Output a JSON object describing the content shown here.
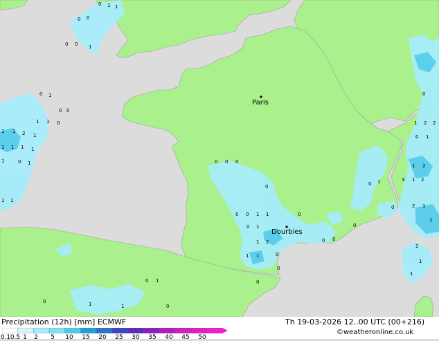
{
  "map": {
    "cities": [
      {
        "name": "Paris"
      },
      {
        "name": "Dourbies"
      }
    ]
  },
  "legend": {
    "title": "Precipitation (12h) [mm]",
    "model": "ECMWF",
    "ticks": [
      "0.1",
      "0.5",
      "1",
      "2",
      "5",
      "10",
      "15",
      "20",
      "25",
      "30",
      "35",
      "40",
      "45",
      "50"
    ],
    "colors": [
      "#ffffff",
      "#d4f4fa",
      "#a6ecfa",
      "#7ee1f5",
      "#4fc9ea",
      "#1e9fd8",
      "#2f6fd0",
      "#3a45c8",
      "#5a2bbf",
      "#8a1fbf",
      "#b31cc0",
      "#d21cc4",
      "#e61cc9",
      "#f01ccf"
    ]
  },
  "valid_time": "Th 19-03-2026 12..00 UTC (00+216)",
  "credit": "©weatheronline.co.uk",
  "colors": {
    "sea": "#dcdcdc",
    "land": "#aaf08c",
    "border": "#a0a0a0",
    "precip_light": "#a6ecfa",
    "precip_mid": "#4fc9ea"
  }
}
